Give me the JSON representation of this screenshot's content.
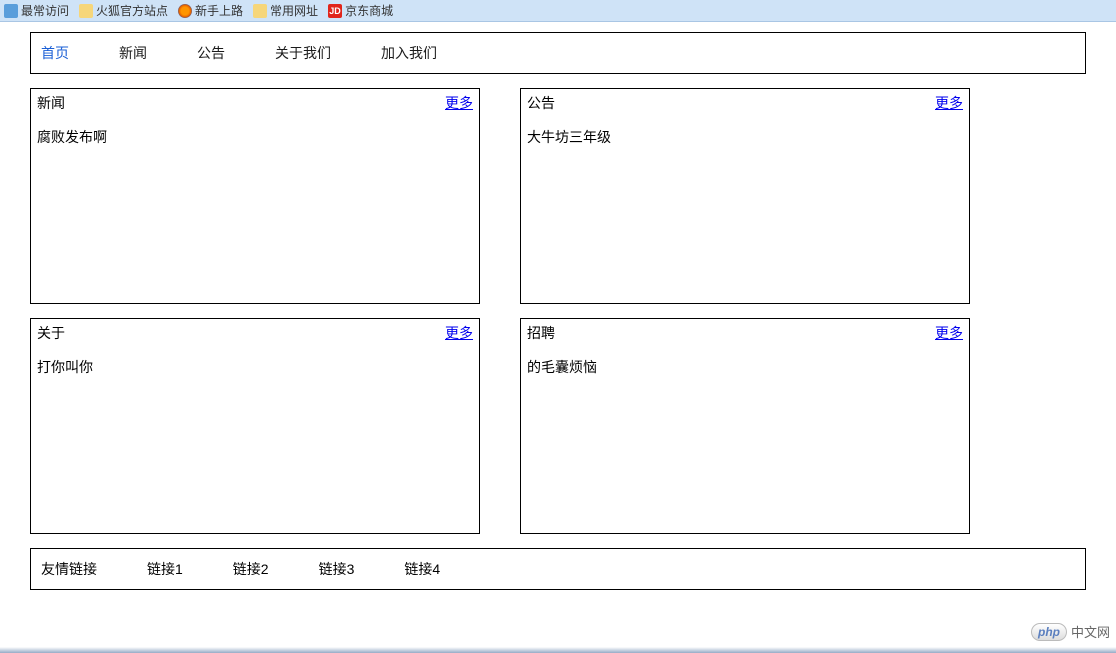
{
  "bookmarks": {
    "items": [
      {
        "label": "最常访问",
        "iconType": "blue"
      },
      {
        "label": "火狐官方站点",
        "iconType": "folder"
      },
      {
        "label": "新手上路",
        "iconType": "firefox"
      },
      {
        "label": "常用网址",
        "iconType": "folder"
      },
      {
        "label": "京东商城",
        "iconType": "jd",
        "iconText": "JD"
      }
    ]
  },
  "nav": {
    "items": [
      {
        "label": "首页",
        "active": true
      },
      {
        "label": "新闻",
        "active": false
      },
      {
        "label": "公告",
        "active": false
      },
      {
        "label": "关于我们",
        "active": false
      },
      {
        "label": "加入我们",
        "active": false
      }
    ]
  },
  "panels": {
    "row1": [
      {
        "title": "新闻",
        "more": "更多",
        "content": "腐败发布啊"
      },
      {
        "title": "公告",
        "more": "更多",
        "content": "大牛坊三年级"
      }
    ],
    "row2": [
      {
        "title": "关于",
        "more": "更多",
        "content": "打你叫你"
      },
      {
        "title": "招聘",
        "more": "更多",
        "content": "的毛囊烦恼"
      }
    ]
  },
  "footer": {
    "label": "友情链接",
    "links": [
      "链接1",
      "链接2",
      "链接3",
      "链接4"
    ]
  },
  "watermark": {
    "logoText": "php",
    "siteText": "中文网"
  }
}
